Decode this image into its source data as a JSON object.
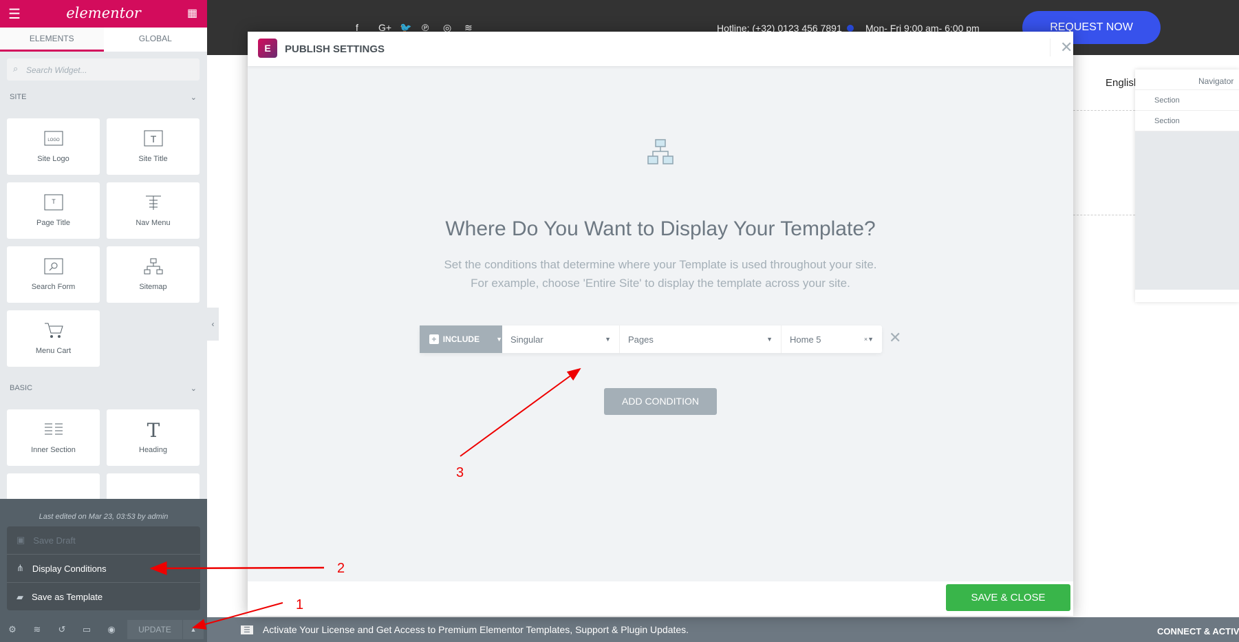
{
  "sidebar": {
    "logo": "elementor",
    "tabs": [
      "ELEMENTS",
      "GLOBAL"
    ],
    "search_placeholder": "Search Widget...",
    "site_label": "SITE",
    "basic_label": "BASIC",
    "site_widgets": [
      "Site Logo",
      "Site Title",
      "Page Title",
      "Nav Menu",
      "Search Form",
      "Sitemap",
      "Menu Cart"
    ],
    "basic_widgets": [
      "Inner Section",
      "Heading"
    ],
    "last_edited": "Last edited on Mar 23, 03:53 by admin",
    "menu": [
      "Save Draft",
      "Display Conditions",
      "Save as Template"
    ],
    "update": "UPDATE"
  },
  "site": {
    "hotline": "Hotline: (+32) 0123 456 7891",
    "hours": "Mon- Fri 9:00 am- 6:00 pm",
    "request": "REQUEST NOW",
    "language": "English"
  },
  "navigator": {
    "title": "Navigator",
    "rows": [
      "Section",
      "Section"
    ]
  },
  "modal": {
    "title": "PUBLISH SETTINGS",
    "heading": "Where Do You Want to Display Your Template?",
    "sub1": "Set the conditions that determine where your Template is used throughout your site.",
    "sub2": "For example, choose 'Entire Site' to display the template across your site.",
    "include": "INCLUDE",
    "type": "Singular",
    "subtype": "Pages",
    "target": "Home 5",
    "add": "ADD CONDITION",
    "save": "SAVE & CLOSE"
  },
  "notice": {
    "text": "Activate Your License and Get Access to Premium Elementor Templates, Support & Plugin Updates.",
    "connect": "CONNECT & ACTIVATE"
  },
  "annotations": [
    "1",
    "2",
    "3"
  ]
}
